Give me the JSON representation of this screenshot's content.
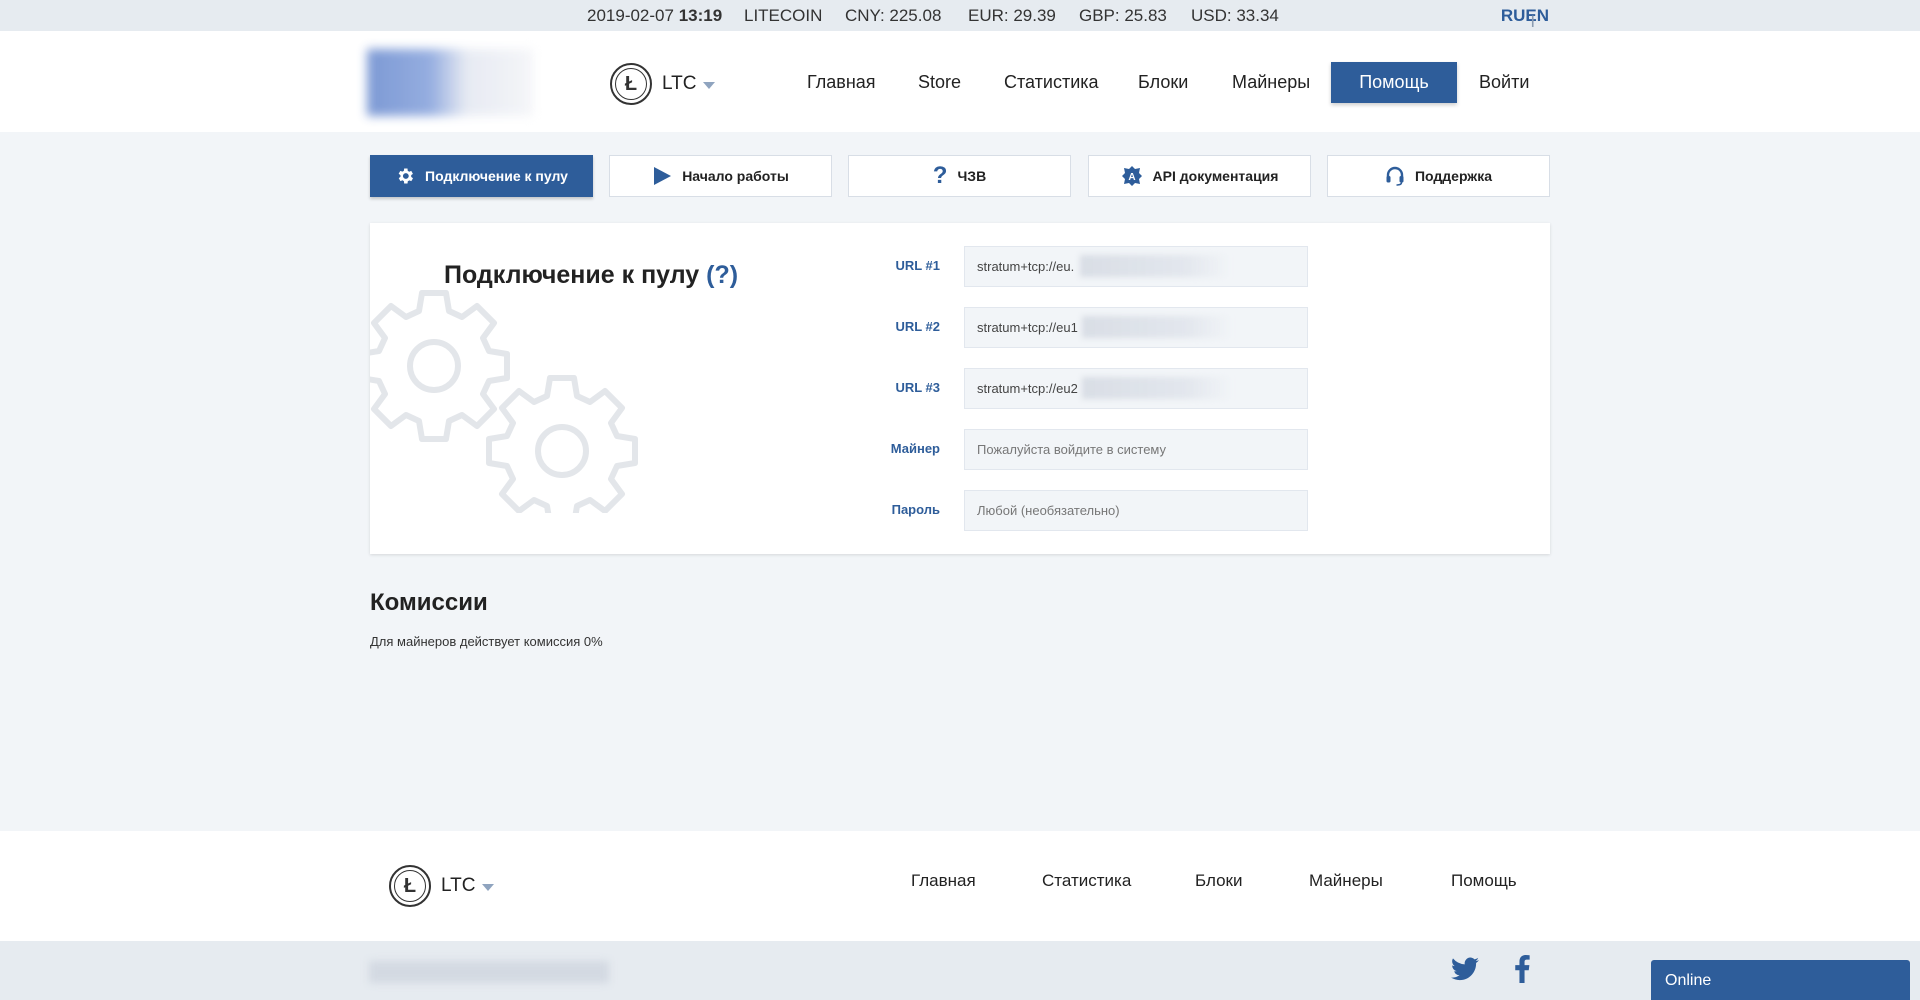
{
  "ticker": {
    "date": "2019-02-07",
    "time": "13:19",
    "coin": "LITECOIN",
    "cny": "CNY: 225.08",
    "eur": "EUR: 29.39",
    "gbp": "GBP: 25.83",
    "usd": "USD: 33.34",
    "lang_ru": "RU",
    "lang_sep": "I",
    "lang_en": "EN"
  },
  "header": {
    "coin_label": "LTC",
    "coin_symbol": "Ł",
    "nav": [
      "Главная",
      "Store",
      "Статистика",
      "Блоки",
      "Майнеры",
      "Помощь",
      "Войти"
    ],
    "active_nav": "Помощь"
  },
  "tabs": [
    {
      "label": "Подключение к пулу",
      "icon": "gear-icon",
      "active": true
    },
    {
      "label": "Начало работы",
      "icon": "play-icon",
      "active": false
    },
    {
      "label": "ЧЗВ",
      "icon": "question-icon",
      "active": false
    },
    {
      "label": "API документация",
      "icon": "api-icon",
      "active": false
    },
    {
      "label": "Поддержка",
      "icon": "headset-icon",
      "active": false
    }
  ],
  "connect": {
    "title": "Подключение к пулу",
    "help": "(?)",
    "fields": [
      {
        "label": "URL #1",
        "value": "stratum+tcp://eu.",
        "placeholder": ""
      },
      {
        "label": "URL #2",
        "value": "stratum+tcp://eu1",
        "placeholder": ""
      },
      {
        "label": "URL #3",
        "value": "stratum+tcp://eu2",
        "placeholder": ""
      },
      {
        "label": "Майнер",
        "value": "",
        "placeholder": "Пожалуйста войдите в систему"
      },
      {
        "label": "Пароль",
        "value": "",
        "placeholder": "Любой (необязательно)"
      }
    ]
  },
  "commissions": {
    "title": "Комиссии",
    "text": "Для майнеров действует комиссия 0%"
  },
  "footer": {
    "coin_label": "LTC",
    "coin_symbol": "Ł",
    "nav": [
      "Главная",
      "Статистика",
      "Блоки",
      "Майнеры",
      "Помощь"
    ],
    "social": [
      "twitter-icon",
      "facebook-icon"
    ],
    "chat_label": "Online"
  },
  "colors": {
    "accent": "#2e5d9a",
    "background": "#f2f5f8",
    "ticker_bg": "#e6ebf0"
  }
}
